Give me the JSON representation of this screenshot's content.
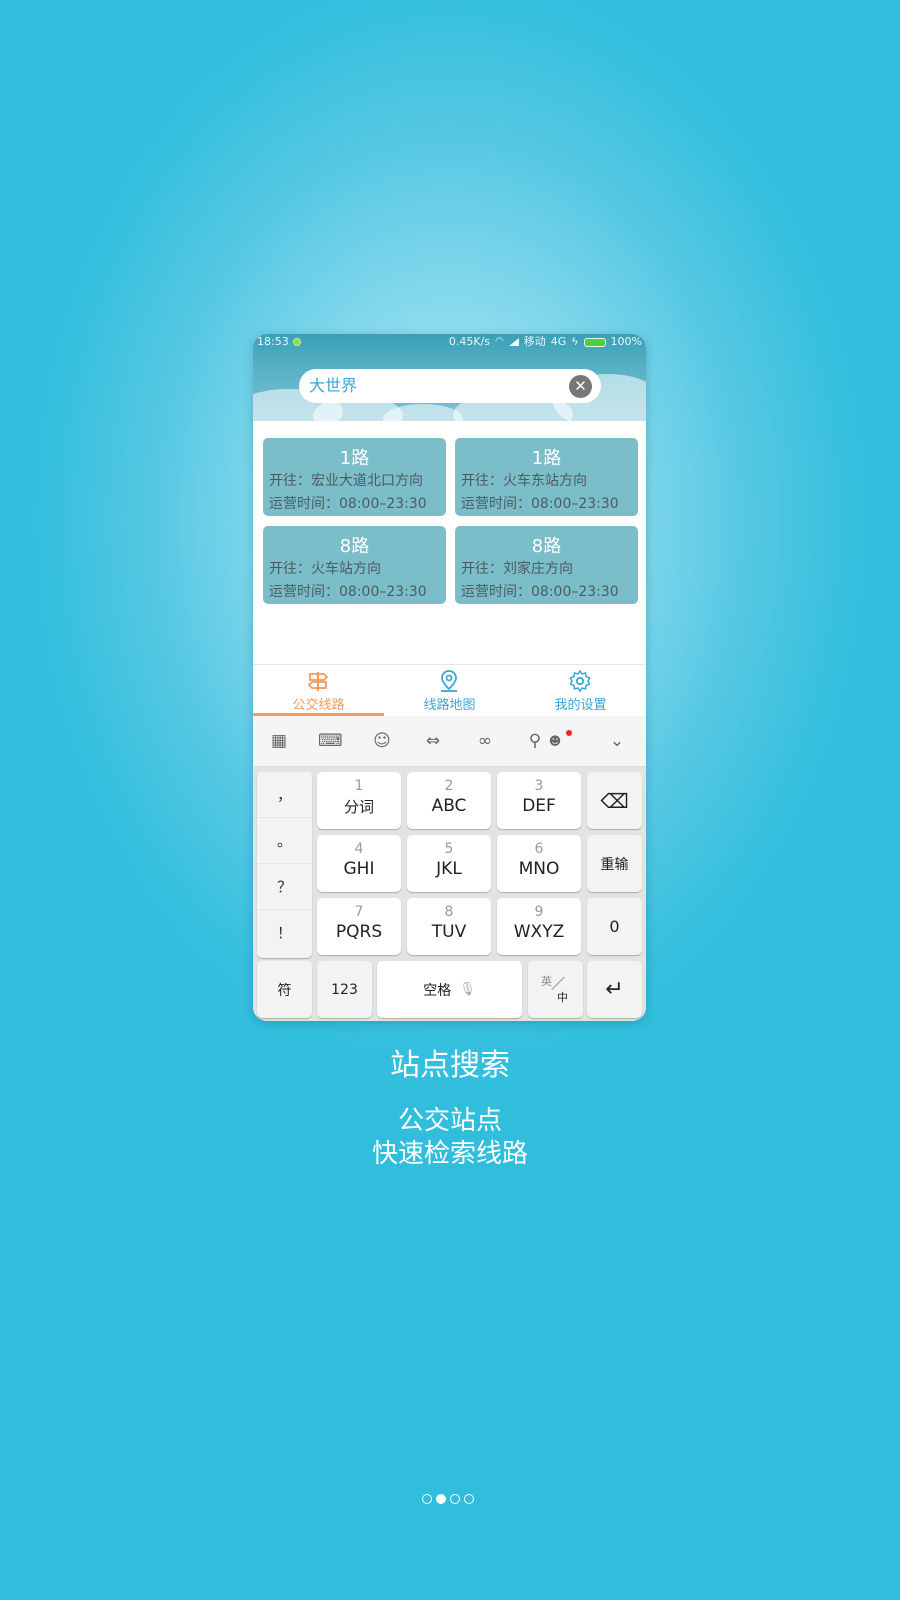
{
  "status_bar": {
    "time": "18:53",
    "network_speed": "0.45K/s",
    "carrier": "移动",
    "network_type": "4G",
    "battery": "100%"
  },
  "search": {
    "value": "大世界"
  },
  "routes": [
    {
      "name": "1路",
      "direction": "开往：宏业大道北口方向",
      "hours": "运营时间：08:00–23:30"
    },
    {
      "name": "1路",
      "direction": "开往：火车东站方向",
      "hours": "运营时间：08:00–23:30"
    },
    {
      "name": "8路",
      "direction": "开往：火车站方向",
      "hours": "运营时间：08:00–23:30"
    },
    {
      "name": "8路",
      "direction": "开往：刘家庄方向",
      "hours": "运营时间：08:00–23:30"
    }
  ],
  "tabs": [
    {
      "label": "公交线路",
      "icon": "signpost-icon",
      "active": true
    },
    {
      "label": "线路地图",
      "icon": "map-pin-icon",
      "active": false
    },
    {
      "label": "我的设置",
      "icon": "gear-icon",
      "active": false
    }
  ],
  "keyboard": {
    "punctuation": [
      "，",
      "。",
      "？",
      "！"
    ],
    "keys": [
      {
        "num": "1",
        "letters": "分词"
      },
      {
        "num": "2",
        "letters": "ABC"
      },
      {
        "num": "3",
        "letters": "DEF"
      },
      {
        "num": "4",
        "letters": "GHI"
      },
      {
        "num": "5",
        "letters": "JKL"
      },
      {
        "num": "6",
        "letters": "MNO"
      },
      {
        "num": "7",
        "letters": "PQRS"
      },
      {
        "num": "8",
        "letters": "TUV"
      },
      {
        "num": "9",
        "letters": "WXYZ"
      }
    ],
    "reinput": "重输",
    "zero": "0",
    "symbol": "符",
    "numeric": "123",
    "space": "空格",
    "lang_en": "英",
    "lang_zh": "中"
  },
  "caption": {
    "title": "站点搜索",
    "line1": "公交站点",
    "line2": "快速检索线路"
  },
  "pager": {
    "total": 4,
    "active_index": 1
  },
  "colors": {
    "accent_orange": "#f39a5a",
    "accent_blue": "#3aa6d6",
    "card_bg": "#7bbdc9"
  }
}
